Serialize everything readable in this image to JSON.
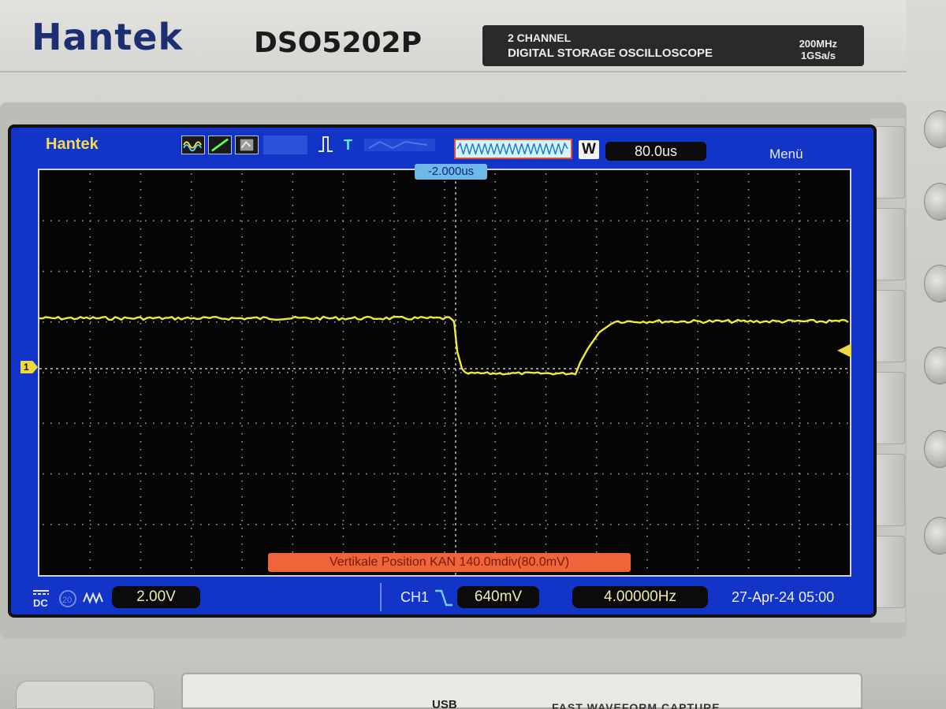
{
  "device": {
    "brand": "Hantek",
    "model": "DSO5202P",
    "spec_line1": "2 CHANNEL",
    "spec_line2": "DIGITAL STORAGE OSCILLOSCOPE",
    "bandwidth": "200MHz",
    "sample_rate": "1GSa/s",
    "usb_label": "USB",
    "fast_capture_label": "FAST WAVEFORM CAPTURE"
  },
  "screen": {
    "brand": "Hantek",
    "menu_label": "Menü",
    "mode_badge": "W",
    "timebase": "80.0us",
    "trigger_position": "-2.000us",
    "channel_marker": "1",
    "vertical_message": "Vertikale  Position  KAN 140.0mdiv(80.0mV)",
    "coupling": "DC",
    "volts_per_div": "2.00V",
    "trigger_source": "CH1",
    "trigger_level": "640mV",
    "frequency": "4.00000Hz",
    "datetime": "27-Apr-24 05:00"
  },
  "colors": {
    "trace": "#f2e838",
    "screen_bg": "#050505",
    "lcd_frame": "#1235c8",
    "grid": "#b8b8b8"
  }
}
